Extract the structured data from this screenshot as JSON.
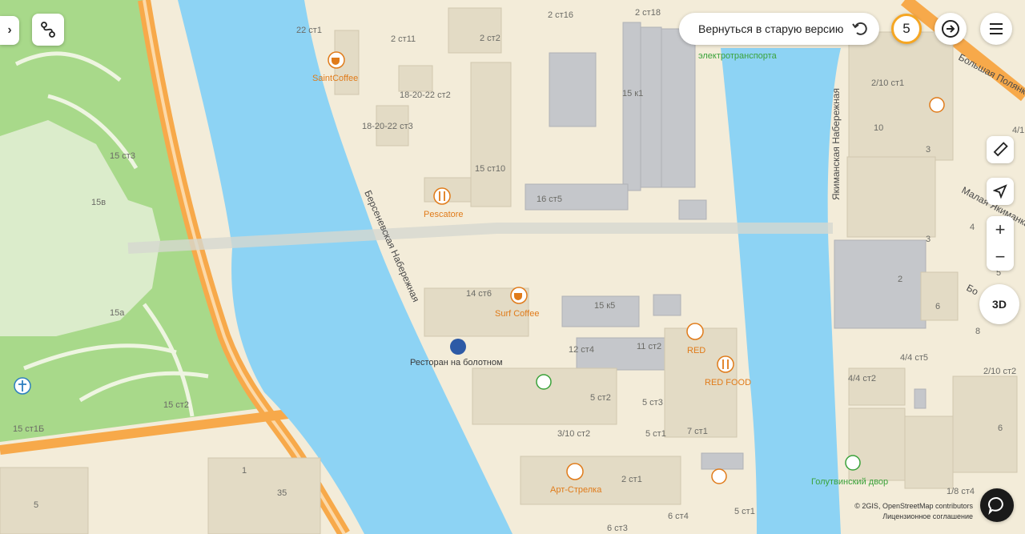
{
  "controls": {
    "old_version_label": "Вернуться в старую версию",
    "zoom_level": "5",
    "three_d_label": "3D",
    "zoom_in": "+",
    "zoom_out": "−"
  },
  "streets": {
    "bersenevskaya": "Берсеневская Набережная",
    "yakimanskaya": "Якиманская Набережная",
    "bolshaya_polyanka": "Большая Полянка",
    "malaya_yakimanka": "Малая Якиманка",
    "bo_partial": "Бо"
  },
  "buildings": {
    "b1": "22 ст1",
    "b2": "2 ст16",
    "b3": "2 ст18",
    "b4": "2 ст11",
    "b5": "2 ст2",
    "b6": "18-20-22 ст2",
    "b7": "18-20-22 ст3",
    "b8": "15 к1",
    "b9": "15 ст10",
    "b10": "16 ст5",
    "b11": "15 ст3",
    "b12": "15в",
    "b13": "15а",
    "b14": "15 ст2",
    "b15": "15 ст1Б",
    "b16": "14 ст6",
    "b17": "15 к5",
    "b18": "12 ст4",
    "b19": "11 ст2",
    "b20": "5 ст2",
    "b21": "5 ст3",
    "b22": "3/10 ст2",
    "b23": "5 ст1",
    "b24": "7 ст1",
    "b25": "2 ст1",
    "b26": "1",
    "b27": "35",
    "b28": "5",
    "b29": "6 ст4",
    "b30": "5 ст1",
    "b31": "6 ст3",
    "b32": "2/10 ст1",
    "b33": "10",
    "b34": "3",
    "b35": "4",
    "b36": "3",
    "b37": "2",
    "b38": "6",
    "b39": "8",
    "b40": "5",
    "b41": "4/4 ст5",
    "b42": "4/4 ст2",
    "b43": "2/10 ст2",
    "b44": "6",
    "b45": "1/8 ст4",
    "b46": "4/1"
  },
  "pois": {
    "saint_coffee": "SaintCoffee",
    "pescatore": "Pescatore",
    "surf_coffee": "Surf Coffee",
    "restaurant": "Ресторан на болотном",
    "red": "RED",
    "red_food": "RED FOOD",
    "art_strelka": "Арт-Стрелка",
    "golutvinsky": "Голутвинский двор",
    "electro_transport": "электротранспорта"
  },
  "attribution": {
    "osm": "© 2GIS, OpenStreetMap contributors",
    "license": "Лицензионное соглашение"
  },
  "colors": {
    "river": "#8dd3f4",
    "land": "#f3ecd9",
    "park": "#a8d98a",
    "highway": "#f7a94a",
    "building": "#c5c7cb",
    "poi": "#e07b1a",
    "zoom_ring": "#f5a623"
  }
}
